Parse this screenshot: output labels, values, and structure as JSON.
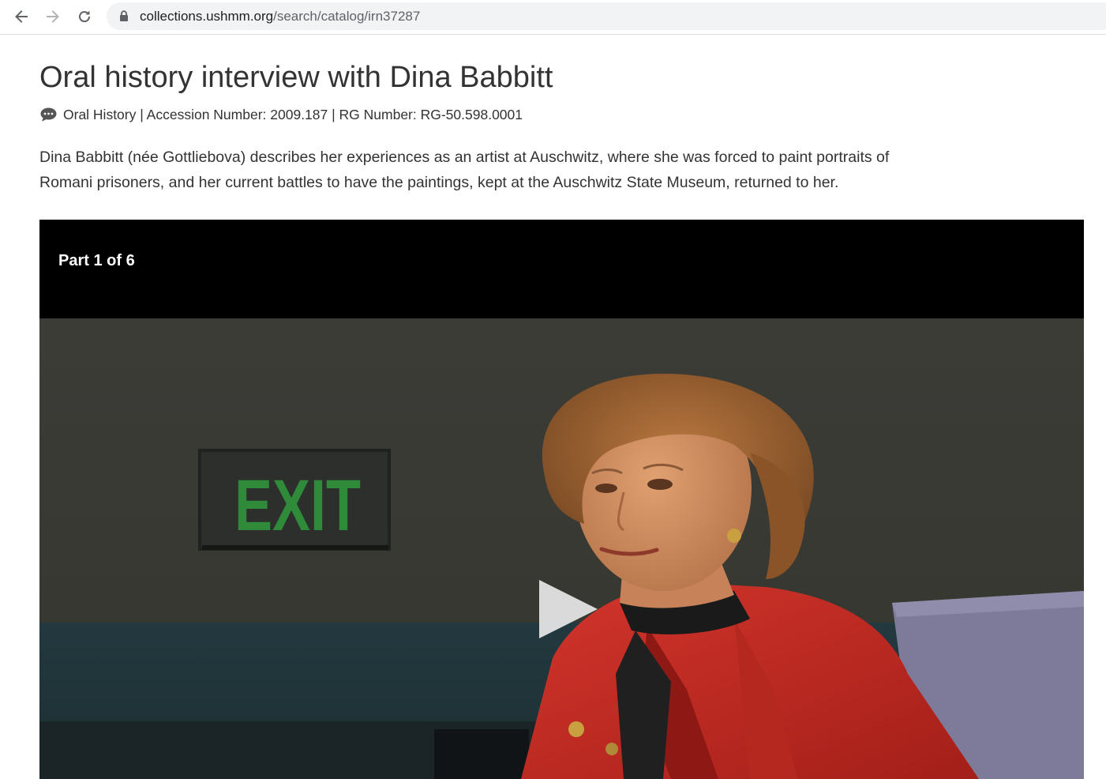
{
  "browser": {
    "url_host": "collections.ushmm.org",
    "url_path": "/search/catalog/irn37287"
  },
  "page": {
    "title": "Oral history interview with Dina Babbitt",
    "meta": "Oral History | Accession Number: 2009.187 | RG Number: RG-50.598.0001",
    "description": "Dina Babbitt (née Gottliebova) describes her experiences as an artist at Auschwitz, where she was forced to paint portraits of Romani prisoners, and her current battles to have the paintings, kept at the Auschwitz State Museum, returned to her."
  },
  "video": {
    "part_label": "Part 1 of 6",
    "sign_text": "EXIT"
  },
  "icons": {
    "back": "arrow-left-icon",
    "forward": "arrow-right-icon",
    "reload": "reload-icon",
    "lock": "lock-icon",
    "meta": "chat-bubble-icon",
    "play": "play-icon"
  },
  "colors": {
    "text": "#333333",
    "exit_sign": "#2f8a3a",
    "jacket": "#c42a22"
  }
}
